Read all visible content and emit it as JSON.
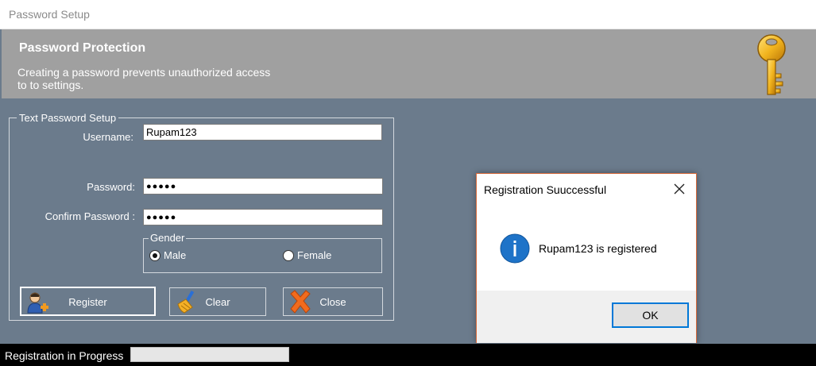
{
  "window": {
    "title": "Password Setup"
  },
  "header": {
    "title": "Password Protection",
    "description": "Creating a password prevents unauthorized access to to settings.",
    "icon": "key-icon"
  },
  "form": {
    "group_title": "Text Password Setup",
    "username_label": "Username:",
    "username_value": "Rupam123",
    "password_label": "Password:",
    "password_value": "●●●●●",
    "confirm_label": "Confirm Password :",
    "confirm_value": "●●●●●",
    "gender": {
      "title": "Gender",
      "options": [
        {
          "label": "Male",
          "selected": true
        },
        {
          "label": "Female",
          "selected": false
        }
      ]
    },
    "buttons": {
      "register": "Register",
      "clear": "Clear",
      "close": "Close"
    }
  },
  "status": {
    "text": "Registration in Progress",
    "progress": 0
  },
  "dialog": {
    "title": "Registration Suuccessful",
    "message": "Rupam123 is registered",
    "ok_label": "OK",
    "icon": "info-icon"
  },
  "colors": {
    "panel_bg": "#6b7b8c",
    "header_bg": "#a0a0a0",
    "dialog_border": "#d86a3a",
    "ok_border": "#0078d7",
    "info_blue": "#1e73c8"
  }
}
